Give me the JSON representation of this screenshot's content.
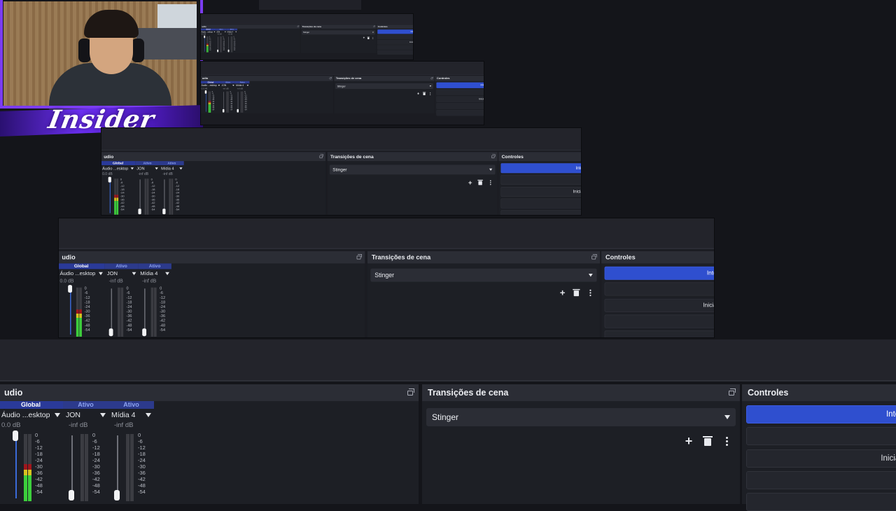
{
  "audio_mixer": {
    "title": "udio",
    "channels": [
      {
        "badge": "Global",
        "name": "Áudio ...esktop",
        "db": "0.0 dB",
        "level": 0.55,
        "muted": false
      },
      {
        "badge": "Ativo",
        "name": "JON",
        "db": "-inf dB",
        "level": 0.0,
        "muted": false
      },
      {
        "badge": "Ativo",
        "name": "Mídia 4",
        "db": "-inf dB",
        "level": 0.0,
        "muted": false
      }
    ],
    "scale": [
      "0",
      "-6",
      "-12",
      "-18",
      "-24",
      "-30",
      "-36",
      "-42",
      "-48",
      "-54"
    ]
  },
  "scene_transitions": {
    "title": "Transições de cena",
    "selected": "Stinger",
    "tools": {
      "add": "+"
    }
  },
  "controls": {
    "title": "Controles",
    "buttons": [
      "Inter",
      "",
      "Iniciar",
      "",
      ""
    ]
  },
  "colors": {
    "accent": "#2f4fcf",
    "meter_green": "#3ccf3c",
    "meter_yellow": "#d8c21f",
    "meter_red": "#a0161d",
    "overlay_purple": "#6b2ff0"
  }
}
